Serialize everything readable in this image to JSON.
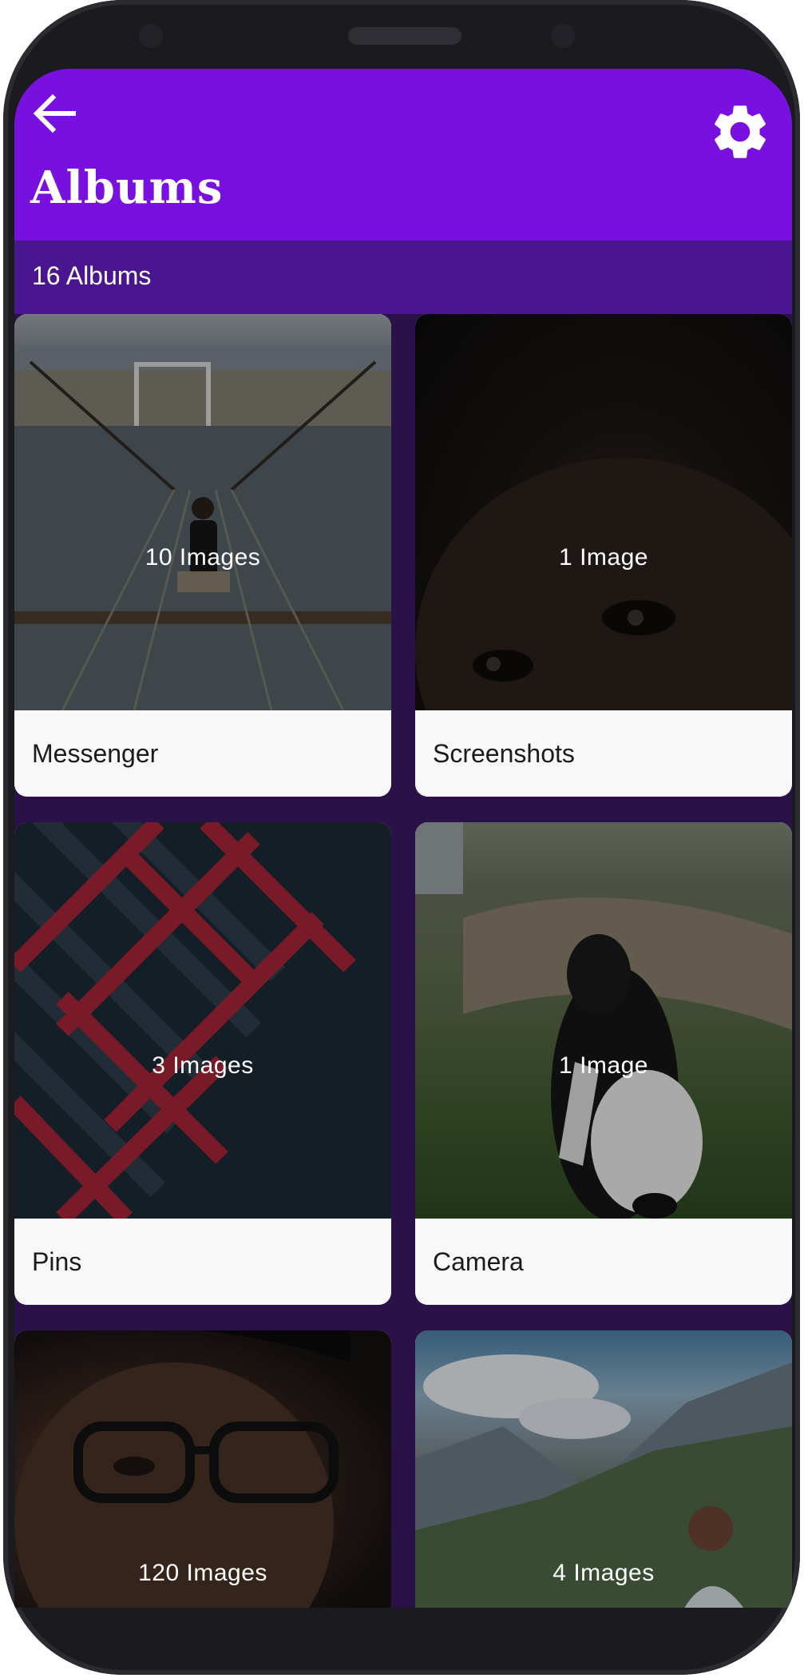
{
  "header": {
    "title": "Albums",
    "back_icon": "arrow-left-icon",
    "settings_icon": "gear-icon",
    "color": "#7810e0"
  },
  "subheader": {
    "count": "16 Albums",
    "color": "#4a1690"
  },
  "albums": [
    {
      "name": "Messenger",
      "count": "10  Images"
    },
    {
      "name": "Screenshots",
      "count": "1  Image"
    },
    {
      "name": "Pins",
      "count": "3  Images"
    },
    {
      "name": "Camera",
      "count": "1  Image"
    },
    {
      "name": "",
      "count": "120  Images"
    },
    {
      "name": "",
      "count": "4  Images"
    }
  ]
}
